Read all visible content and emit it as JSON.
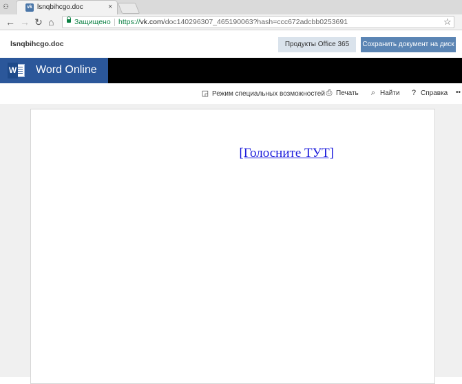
{
  "browser": {
    "tab_title": "lsnqbihcgo.doc",
    "tab_close": "×",
    "secure_label": "Защищено",
    "url_proto": "https://",
    "url_host": "vk.com",
    "url_path": "/doc140296307_465190063?hash=ccc672adcbb0253691"
  },
  "header": {
    "doc_name": "lsnqbihcgo.doc",
    "office_button": "Продукты Office 365",
    "save_button": "Сохранить документ на диск"
  },
  "banner": {
    "app_name": "Word Online",
    "logo_letter": "W"
  },
  "commands": {
    "accessibility": "Режим специальных возможностей",
    "print": "Печать",
    "find": "Найти",
    "help": "Справка",
    "more": "••"
  },
  "document": {
    "link_text": "[Голосните ТУТ]"
  },
  "colors": {
    "brand": "#2b579a",
    "save_button": "#5b85b4",
    "office_button": "#dae3ec",
    "secure": "#0b8043",
    "link": "#1a1adb"
  }
}
